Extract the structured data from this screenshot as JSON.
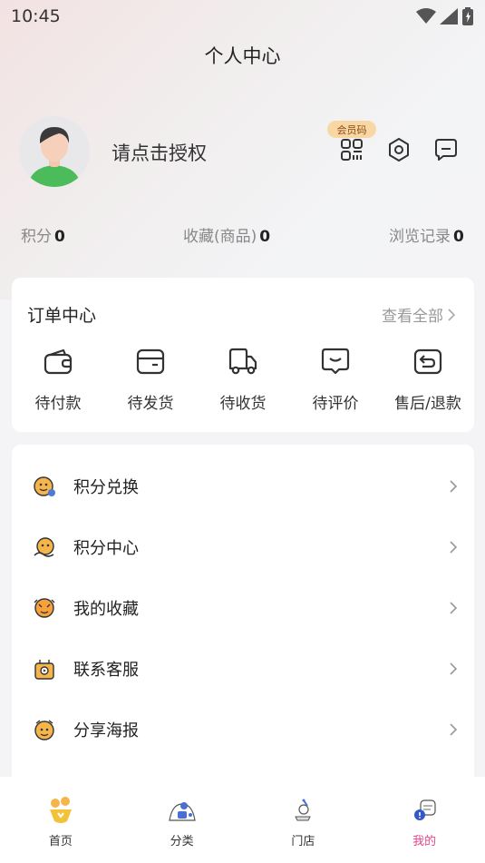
{
  "status_bar": {
    "time": "10:45"
  },
  "header": {
    "title": "个人中心"
  },
  "profile": {
    "name": "请点击授权",
    "member_badge": "会员码"
  },
  "stats": [
    {
      "label": "积分",
      "value": "0"
    },
    {
      "label": "收藏(商品)",
      "value": "0"
    },
    {
      "label": "浏览记录",
      "value": "0"
    }
  ],
  "orders": {
    "title": "订单中心",
    "view_all": "查看全部",
    "items": [
      {
        "label": "待付款",
        "icon": "wallet-icon"
      },
      {
        "label": "待发货",
        "icon": "box-icon"
      },
      {
        "label": "待收货",
        "icon": "truck-icon"
      },
      {
        "label": "待评价",
        "icon": "comment-icon"
      },
      {
        "label": "售后/退款",
        "icon": "return-icon"
      }
    ]
  },
  "menu": [
    {
      "label": "积分兑换",
      "icon": "points-exchange-icon"
    },
    {
      "label": "积分中心",
      "icon": "points-center-icon"
    },
    {
      "label": "我的收藏",
      "icon": "favorites-icon"
    },
    {
      "label": "联系客服",
      "icon": "customer-service-icon"
    },
    {
      "label": "分享海报",
      "icon": "share-poster-icon"
    }
  ],
  "tabbar": [
    {
      "label": "首页",
      "icon": "home-icon",
      "active": false
    },
    {
      "label": "分类",
      "icon": "category-icon",
      "active": false
    },
    {
      "label": "门店",
      "icon": "store-icon",
      "active": false
    },
    {
      "label": "我的",
      "icon": "profile-icon",
      "active": true
    }
  ],
  "colors": {
    "accent": "#e8468a",
    "badge_bg": "#f9d7a5",
    "avatar_shirt": "#4cbb5a"
  }
}
